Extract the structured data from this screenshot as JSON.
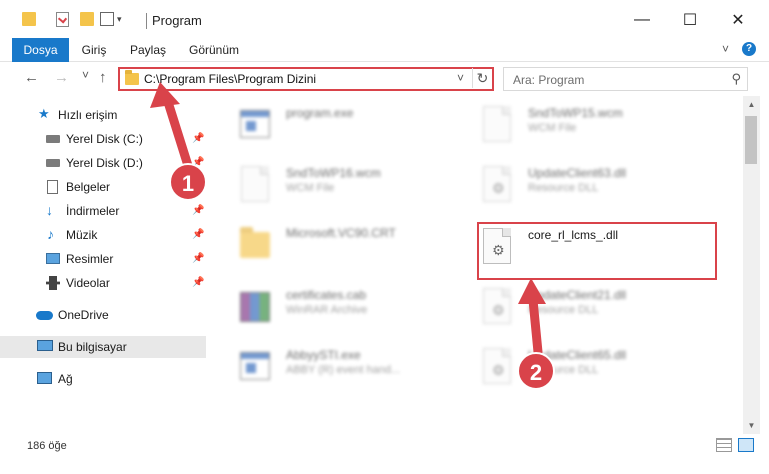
{
  "window": {
    "title": "Program",
    "minimize": "—",
    "maximize": "☐",
    "close": "✕"
  },
  "ribbon": {
    "tabs": [
      {
        "label": "Dosya"
      },
      {
        "label": "Giriş"
      },
      {
        "label": "Paylaş"
      },
      {
        "label": "Görünüm"
      }
    ],
    "collapse": "˅",
    "help": "?"
  },
  "address": {
    "path": "C:\\Program Files\\Program Dizini",
    "chevron": "˅",
    "refresh": "↻"
  },
  "search": {
    "placeholder": "Ara: Program",
    "icon": "⚲"
  },
  "nav": {
    "back": "←",
    "forward": "→",
    "recent": "˅",
    "up": "↑"
  },
  "sidebar": {
    "items": [
      {
        "label": "Hızlı erişim"
      },
      {
        "label": "Yerel Disk (C:)"
      },
      {
        "label": "Yerel Disk (D:)"
      },
      {
        "label": "Belgeler"
      },
      {
        "label": "İndirmeler"
      },
      {
        "label": "Müzik"
      },
      {
        "label": "Resimler"
      },
      {
        "label": "Videolar"
      },
      {
        "label": "OneDrive"
      },
      {
        "label": "Bu bilgisayar"
      },
      {
        "label": "Ağ"
      }
    ]
  },
  "files": [
    {
      "name": "program.exe",
      "type": ""
    },
    {
      "name": "SndToWP15.wcm",
      "type": "WCM File"
    },
    {
      "name": "SndToWP16.wcm",
      "type": "WCM File"
    },
    {
      "name": "UpdateClient63.dll",
      "type": "Resource DLL"
    },
    {
      "name": "Microsoft.VC90.CRT",
      "type": ""
    },
    {
      "name": "core_rl_lcms_.dll",
      "type": ""
    },
    {
      "name": "certificates.cab",
      "type": "WinRAR Archive"
    },
    {
      "name": "UpdateClient21.dll",
      "type": "Resource DLL"
    },
    {
      "name": "AbbyySTI.exe",
      "type": "ABBY (R) event hand..."
    },
    {
      "name": "UpdateClient65.dll",
      "type": "Resource DLL"
    }
  ],
  "status": {
    "count": "186 öğe"
  },
  "annotations": {
    "one": "1",
    "two": "2"
  },
  "colors": {
    "accent": "#1979ca",
    "highlight_box": "#d9434a"
  }
}
